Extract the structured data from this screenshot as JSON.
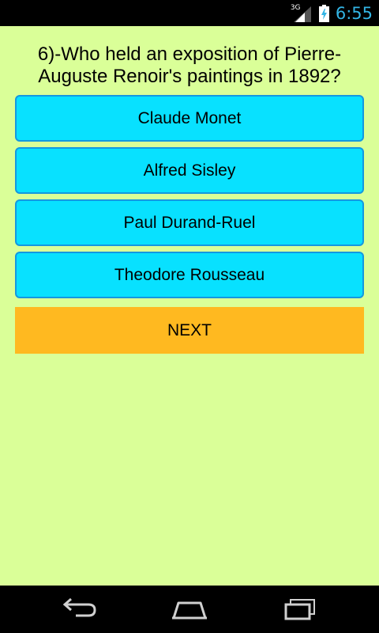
{
  "status_bar": {
    "network_label": "3G",
    "time": "6:55"
  },
  "quiz": {
    "question": "6)-Who held an exposition of Pierre-Auguste Renoir's paintings in 1892?",
    "answers": [
      {
        "label": "Claude Monet"
      },
      {
        "label": "Alfred Sisley"
      },
      {
        "label": "Paul Durand-Ruel"
      },
      {
        "label": "Theodore Rousseau"
      }
    ],
    "next_label": "NEXT"
  },
  "colors": {
    "background": "#daff98",
    "answer_fill": "#08e1ff",
    "answer_border": "#1498e0",
    "next_fill": "#ffb920",
    "status_accent": "#33b5e5"
  },
  "nav_bar": {
    "buttons": [
      "back-icon",
      "home-icon",
      "recent-apps-icon"
    ]
  }
}
